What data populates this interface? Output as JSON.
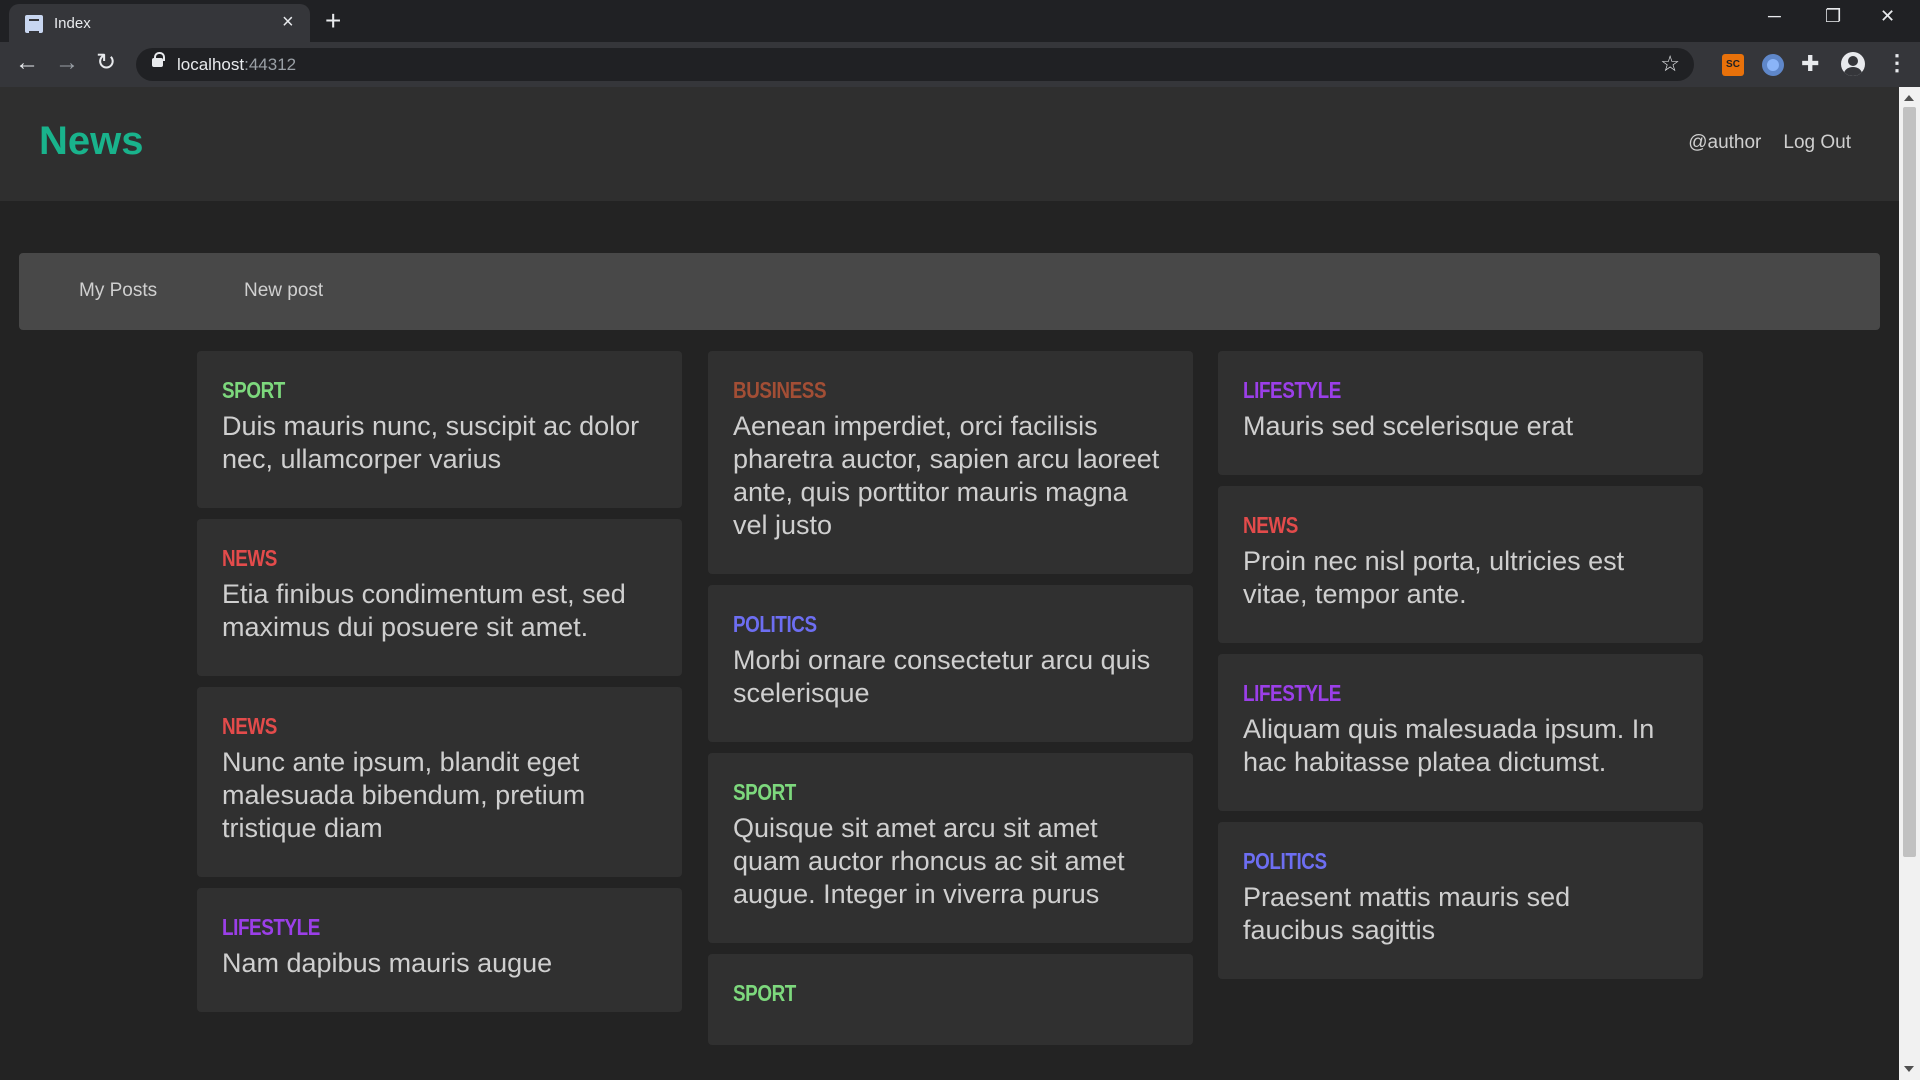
{
  "browser": {
    "tab_title": "Index",
    "url_host": "localhost",
    "url_port": ":44312",
    "extension_label": "SC"
  },
  "site": {
    "brand": "News",
    "author_link": "@author",
    "logout_link": "Log Out"
  },
  "subnav": {
    "my_posts": "My Posts",
    "new_post": "New post"
  },
  "tag_colors": {
    "SPORT": "#7dd87d",
    "BUSINESS": "#a24e35",
    "LIFESTYLE": "#9b3fe8",
    "NEWS": "#e34b4b",
    "POLITICS": "#6d6ef2"
  },
  "columns": [
    [
      {
        "tag": "SPORT",
        "title": "Duis mauris nunc, suscipit ac dolor nec, ullamcorper varius"
      },
      {
        "tag": "NEWS",
        "title": "Etia finibus condimentum est, sed maximus dui posuere sit amet."
      },
      {
        "tag": "NEWS",
        "title": "Nunc ante ipsum, blandit eget malesuada bibendum, pretium tristique diam"
      },
      {
        "tag": "LIFESTYLE",
        "title": "Nam dapibus mauris augue"
      }
    ],
    [
      {
        "tag": "BUSINESS",
        "title": "Aenean imperdiet, orci facilisis pharetra auctor, sapien arcu laoreet ante, quis porttitor mauris magna vel justo"
      },
      {
        "tag": "POLITICS",
        "title": "Morbi ornare consectetur arcu quis scelerisque"
      },
      {
        "tag": "SPORT",
        "title": "Quisque sit amet arcu sit amet quam auctor rhoncus ac sit amet augue. Integer in viverra purus"
      },
      {
        "tag": "SPORT",
        "title": ""
      }
    ],
    [
      {
        "tag": "LIFESTYLE",
        "title": "Mauris sed scelerisque erat"
      },
      {
        "tag": "NEWS",
        "title": "Proin nec nisl porta, ultricies est vitae, tempor ante."
      },
      {
        "tag": "LIFESTYLE",
        "title": "Aliquam quis malesuada ipsum. In hac habitasse platea dictumst."
      },
      {
        "tag": "POLITICS",
        "title": "Praesent mattis mauris sed faucibus sagittis"
      }
    ]
  ]
}
